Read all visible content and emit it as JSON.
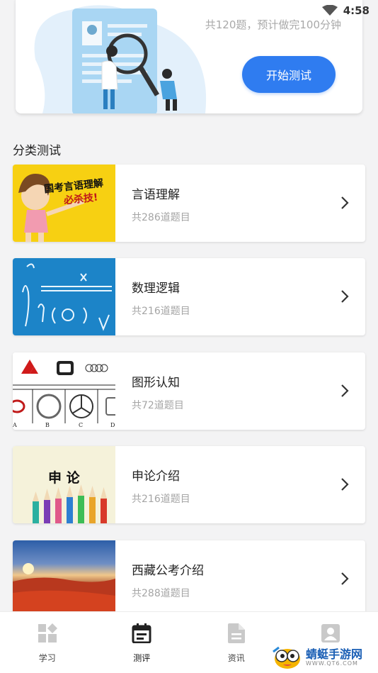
{
  "status_bar": {
    "time": "4:58"
  },
  "hero": {
    "info": "共120题，预计做完100分钟",
    "start_label": "开始测试"
  },
  "section_title": "分类测试",
  "categories": [
    {
      "name": "言语理解",
      "count": "共286道题目",
      "thumb_text": [
        "国考言语理解",
        "必杀技!"
      ]
    },
    {
      "name": "数理逻辑",
      "count": "共216道题目"
    },
    {
      "name": "图形认知",
      "count": "共72道题目",
      "thumb_labels": [
        "A",
        "B",
        "C",
        "D"
      ]
    },
    {
      "name": "申论介绍",
      "count": "共216道题目",
      "thumb_text": "申 论"
    },
    {
      "name": "西藏公考介绍",
      "count": "共288道题目"
    }
  ],
  "nav": [
    {
      "label": "学习",
      "icon": "grid-icon"
    },
    {
      "label": "测评",
      "icon": "calendar-icon",
      "active": true
    },
    {
      "label": "资讯",
      "icon": "document-icon"
    },
    {
      "label": "",
      "icon": "profile-icon"
    }
  ],
  "watermark": {
    "name": "蜻蜓手游网",
    "url": "WWW.QT6.COM"
  },
  "colors": {
    "accent": "#2f7cf0",
    "background": "#f3f3f4"
  }
}
